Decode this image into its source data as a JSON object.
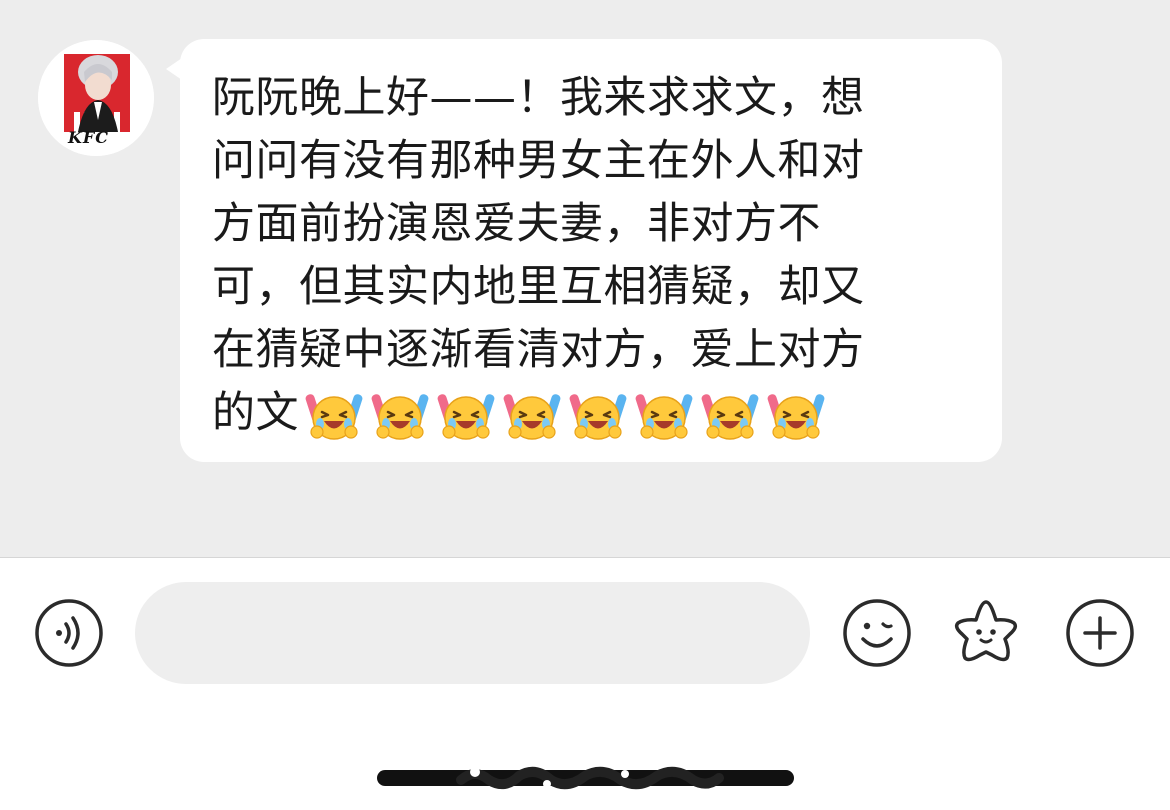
{
  "message": {
    "lines": [
      "阮阮晚上好——！我来求求文，想",
      "问问有没有那种男女主在外人和对",
      "方面前扮演恩爱夫妻，非对方不",
      "可，但其实内地里互相猜疑，却又",
      "在猜疑中逐渐看清对方，爱上对方",
      "的文"
    ],
    "emoji_name": "crying-laughing-with-lightsticks",
    "emoji_count": 8
  },
  "avatar": {
    "logo_text": "KFC"
  },
  "input_bar": {
    "placeholder": "",
    "value": ""
  },
  "icons": {
    "voice": "voice-icon",
    "emoji": "emoji-face-icon",
    "sticker": "sticker-star-icon",
    "more": "plus-icon"
  },
  "colors": {
    "chat_background": "#ededed",
    "bubble": "#ffffff",
    "input_background": "#eeeeee",
    "icon_stroke": "#2b2b2b",
    "avatar_red": "#d9272e"
  }
}
